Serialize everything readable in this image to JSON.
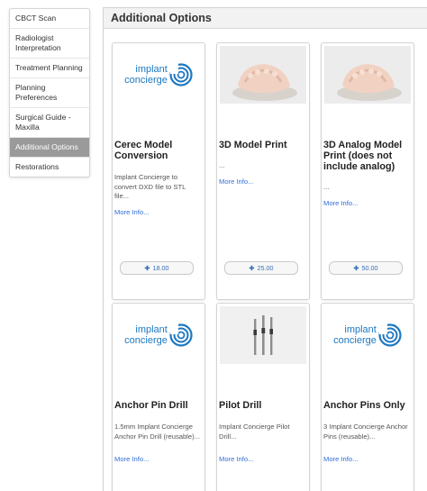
{
  "sidebar": {
    "items": [
      {
        "label": "CBCT Scan",
        "active": false
      },
      {
        "label": "Radiologist Interpretation",
        "active": false
      },
      {
        "label": "Treatment Planning",
        "active": false
      },
      {
        "label": "Planning Preferences",
        "active": false
      },
      {
        "label": "Surgical Guide - Maxilla",
        "active": false
      },
      {
        "label": "Additional Options",
        "active": true
      },
      {
        "label": "Restorations",
        "active": false
      }
    ]
  },
  "panel": {
    "title": "Additional Options"
  },
  "logo": {
    "line1": "implant",
    "line2": "concierge"
  },
  "colors": {
    "brand": "#1d78c1",
    "link": "#2f6fd8",
    "active_sidebar": "#9a9a9a"
  },
  "cards": [
    {
      "image": "implant-concierge-logo",
      "title": "Cerec Model Conversion",
      "description": "Implant Concierge to convert DXD file to STL file...",
      "more": "More Info...",
      "price": "18.00"
    },
    {
      "image": "3d-printed-dental-model",
      "title": "3D Model Print",
      "description": "...",
      "more": "More Info...",
      "price": "25.00"
    },
    {
      "image": "3d-printed-dental-model",
      "title": "3D Analog Model Print (does not include analog)",
      "description": "...",
      "more": "More Info...",
      "price": "50.00"
    },
    {
      "image": "implant-concierge-logo",
      "title": "Anchor Pin Drill",
      "description": "1.5mm Implant Concierge Anchor Pin Drill (reusable)...",
      "more": "More Info..."
    },
    {
      "image": "pilot-drills-photo",
      "title": "Pilot Drill",
      "description": "Implant Concierge Pilot Drill...",
      "more": "More Info..."
    },
    {
      "image": "implant-concierge-logo",
      "title": "Anchor Pins Only",
      "description": "3 Implant Concierge Anchor Pins (reusable)...",
      "more": "More Info..."
    }
  ]
}
